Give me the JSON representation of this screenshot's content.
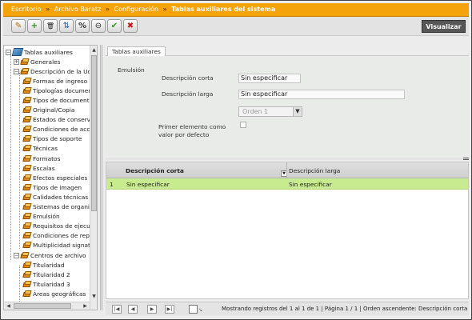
{
  "breadcrumb": {
    "items": [
      "Escritorio",
      "Archivo Baratz",
      "Configuración"
    ],
    "current": "Tablas auxiliares del sistema",
    "separator": "»"
  },
  "toolbar": {
    "buttons": [
      {
        "name": "edit-icon",
        "glyph": "✎"
      },
      {
        "name": "add-icon",
        "glyph": "+"
      },
      {
        "name": "delete-icon",
        "glyph": "🗑"
      },
      {
        "name": "sort-az-icon",
        "glyph": "⇅"
      },
      {
        "name": "percent-icon",
        "glyph": "%"
      },
      {
        "name": "stop-icon",
        "glyph": "⊖"
      },
      {
        "name": "accept-icon",
        "glyph": "✔"
      },
      {
        "name": "cancel-icon",
        "glyph": "✖"
      }
    ],
    "view_label": "Visualizar"
  },
  "tree": {
    "root": "Tablas auxiliares",
    "items": [
      {
        "label": "Generales",
        "level": 1,
        "expander": "+"
      },
      {
        "label": "Descripción de la Ud...",
        "level": 1,
        "expander": "-"
      },
      {
        "label": "Formas de ingreso",
        "level": 2
      },
      {
        "label": "Tipologías documentales",
        "level": 2
      },
      {
        "label": "Tipos de documento",
        "level": 2
      },
      {
        "label": "Original/Copia",
        "level": 2
      },
      {
        "label": "Estados de conservación",
        "level": 2
      },
      {
        "label": "Condiciones de acceso",
        "level": 2
      },
      {
        "label": "Tipos de soporte",
        "level": 2
      },
      {
        "label": "Técnicas",
        "level": 2
      },
      {
        "label": "Formatos",
        "level": 2
      },
      {
        "label": "Escalas",
        "level": 2
      },
      {
        "label": "Efectos especiales",
        "level": 2
      },
      {
        "label": "Tipos de imagen",
        "level": 2
      },
      {
        "label": "Calidades técnicas",
        "level": 2
      },
      {
        "label": "Sistemas de organización",
        "level": 2
      },
      {
        "label": "Emulsión",
        "level": 2
      },
      {
        "label": "Requisitos de ejecución",
        "level": 2
      },
      {
        "label": "Condiciones de reproducción",
        "level": 2
      },
      {
        "label": "Multiplicidad signatura",
        "level": 2
      },
      {
        "label": "Centros de archivo",
        "level": 1,
        "expander": "-"
      },
      {
        "label": "Titularidad",
        "level": 2
      },
      {
        "label": "Titularidad 2",
        "level": 2
      },
      {
        "label": "Titularidad 3",
        "level": 2
      },
      {
        "label": "Áreas geográficas",
        "level": 2
      }
    ]
  },
  "tabs": [
    "Tablas auxiliares"
  ],
  "form": {
    "section": "Emulsión",
    "short_label": "Descripción corta",
    "short_value": "Sin especificar",
    "long_label": "Descripción larga",
    "long_value": "Sin especificar",
    "order_value": "Orden 1",
    "first_default_label_1": "Primer elemento como",
    "first_default_label_2": "valor por defecto"
  },
  "grid": {
    "columns": [
      "Descripción corta",
      "Descripción larga"
    ],
    "rows": [
      {
        "n": "1",
        "short": "Sin especificar",
        "long": "Sin especificar"
      }
    ]
  },
  "pager": {
    "status": "Mostrando registros del 1 al 1 de 1 | Página 1 / 1 | Orden ascendente: Descripción corta"
  },
  "colors": {
    "breadcrumb_bg": "#f4a30a",
    "selected_row": "#c9eb8f",
    "view_button": "#575757"
  }
}
